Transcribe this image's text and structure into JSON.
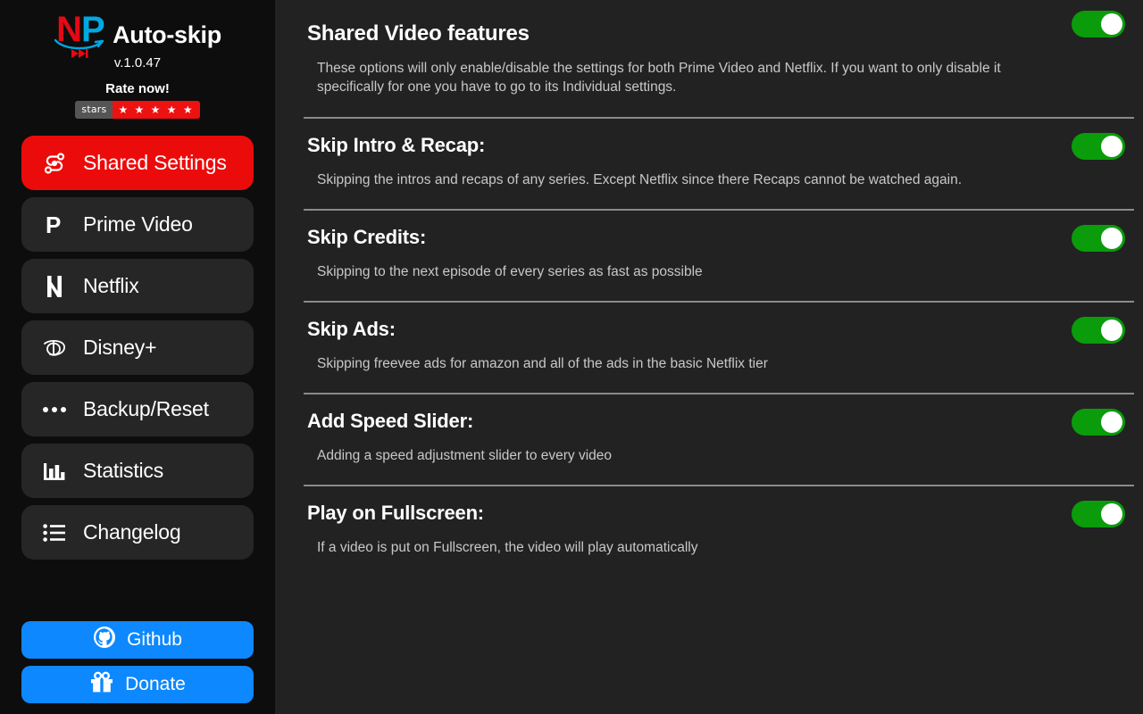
{
  "sidebar": {
    "logo": {
      "mark_n": "N",
      "mark_p": "P",
      "icon_smile": "amazon-smile-arc",
      "icon_fastforward": "fast-forward-icon"
    },
    "app_title": "Auto-skip",
    "version": "v.1.0.47",
    "rate_now": "Rate now!",
    "badge": {
      "left": "stars",
      "right": "★ ★ ★ ★ ★"
    },
    "items": [
      {
        "label": "Shared Settings",
        "icon": "share-nodes-icon",
        "active": true
      },
      {
        "label": "Prime Video",
        "icon": "prime-video-icon",
        "active": false
      },
      {
        "label": "Netflix",
        "icon": "netflix-n-icon",
        "active": false
      },
      {
        "label": "Disney+",
        "icon": "disney-d-icon",
        "active": false
      },
      {
        "label": "Backup/Reset",
        "icon": "ellipsis-icon",
        "active": false
      },
      {
        "label": "Statistics",
        "icon": "bar-chart-icon",
        "active": false
      },
      {
        "label": "Changelog",
        "icon": "list-icon",
        "active": false
      }
    ],
    "buttons": [
      {
        "label": "Github",
        "icon": "github-icon"
      },
      {
        "label": "Donate",
        "icon": "gift-icon"
      }
    ]
  },
  "main": {
    "rows": [
      {
        "title": "Shared Video features",
        "desc": "These options will only enable/disable the settings for both Prime Video and Netflix. If you want to only disable it specifically for one you have to go to its Individual settings.",
        "toggle": "on"
      },
      {
        "title": "Skip Intro & Recap:",
        "desc": "Skipping the intros and recaps of any series. Except Netflix since there Recaps cannot be watched again.",
        "toggle": "on"
      },
      {
        "title": "Skip Credits:",
        "desc": "Skipping to the next episode of every series as fast as possible",
        "toggle": "on"
      },
      {
        "title": "Skip Ads:",
        "desc": "Skipping freevee ads for amazon and all of the ads in the basic Netflix tier",
        "toggle": "on"
      },
      {
        "title": "Add Speed Slider:",
        "desc": "Adding a speed adjustment slider to every video",
        "toggle": "on"
      },
      {
        "title": "Play on Fullscreen:",
        "desc": "If a video is put on Fullscreen, the video will play automatically",
        "toggle": "on"
      }
    ]
  },
  "colors": {
    "accent_red": "#ec0b0b",
    "toggle_on": "#0a9c0a",
    "button_blue": "#0d88ff",
    "netflix_red": "#e50914",
    "prime_blue": "#00a8e1",
    "sidebar_bg": "#0d0d0d",
    "main_bg": "#222222"
  }
}
